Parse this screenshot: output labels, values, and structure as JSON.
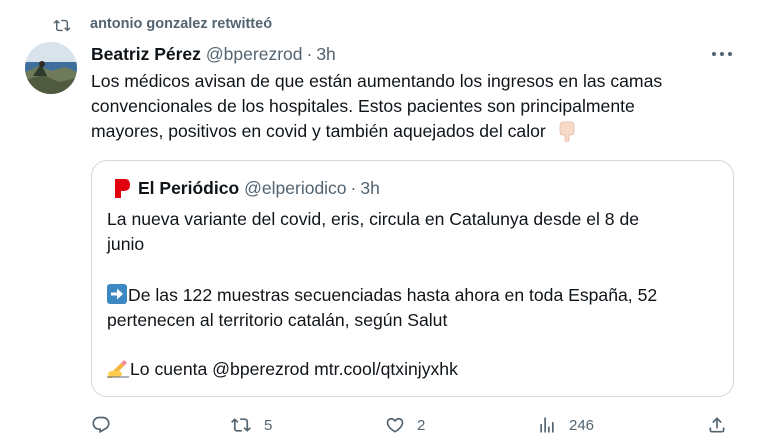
{
  "retweet": {
    "text": "antonio gonzalez retwitteó"
  },
  "tweet": {
    "name": "Beatriz Pérez",
    "handle": "@bperezrod",
    "separator": "·",
    "time": "3h",
    "lines": [
      "Los médicos avisan de que están aumentando los ingresos en las camas",
      "convencionales de los hospitales. Estos pacientes son principalmente",
      "mayores, positivos en covid y también aquejados del calor"
    ],
    "trailing_emoji": "point-down-emoji"
  },
  "quote": {
    "name": "El Periódico",
    "handle": "@elperiodico",
    "separator": "·",
    "time": "3h",
    "lines": [
      "La nueva variante del covid, eris, circula en Catalunya desde el 8 de",
      "junio",
      "De las 122 muestras secuenciadas hasta ahora en toda España, 52",
      "pertenecen al territorio catalán, según Salut",
      "Lo cuenta @bperezrod mtr.cool/qtxinjyxhk"
    ],
    "line3_emoji": "arrow-right-emoji",
    "line5_emoji": "writing-hand-emoji",
    "brand_color": "#e3000f"
  },
  "actions": {
    "reply_count": "",
    "retweet_count": "5",
    "like_count": "2",
    "views_count": "246"
  },
  "colors": {
    "text": "#0f1419",
    "secondary": "#536471",
    "border": "#cfd9de",
    "accent": "#1d9bf0"
  }
}
